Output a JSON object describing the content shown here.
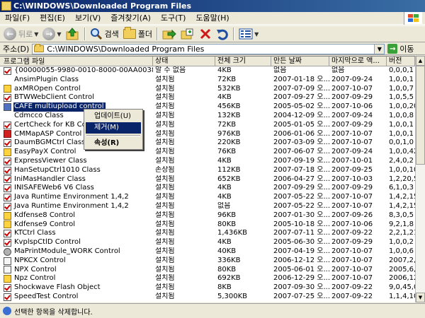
{
  "window": {
    "title": "C:\\WINDOWS\\Downloaded Program Files"
  },
  "menu": [
    "파일(F)",
    "편집(E)",
    "보기(V)",
    "즐겨찾기(A)",
    "도구(T)",
    "도움말(H)"
  ],
  "toolbar": {
    "back_label": "뒤로",
    "search_label": "검색",
    "folders_label": "폴더"
  },
  "address": {
    "label": "주소(D)",
    "value": "C:\\WINDOWS\\Downloaded Program Files",
    "go_label": "이동"
  },
  "columns": [
    "프로그램 파일",
    "상태",
    "전체 크기",
    "만든 날짜",
    "마지막으로 액...",
    "버전"
  ],
  "rows": [
    {
      "name": "{00000055-9980-0010-8000-00AA00389B71}",
      "status": "알 수 없음",
      "size": "4KB",
      "created": "없음",
      "last": "없음",
      "version": "0,0,0,1",
      "icon": "check"
    },
    {
      "name": "AnsimPlugin Class",
      "status": "설치됨",
      "size": "72KB",
      "created": "2007-01-18 오...",
      "last": "2007-09-24",
      "version": "1,0,0,1",
      "icon": "none"
    },
    {
      "name": "axMROpen Control",
      "status": "설치됨",
      "size": "532KB",
      "created": "2007-07-09 오...",
      "last": "2007-10-07",
      "version": "1,0,0,7",
      "icon": "warn"
    },
    {
      "name": "BTWWebClient Control",
      "status": "설치됨",
      "size": "4KB",
      "created": "2007-09-27 오...",
      "last": "2007-09-29",
      "version": "1,0,5,5",
      "icon": "check"
    },
    {
      "name": "CAFE multiupload control",
      "status": "설치됨",
      "size": "456KB",
      "created": "2005-05-02 오...",
      "last": "2007-10-06",
      "version": "1,0,0,20",
      "icon": "blue",
      "selected": true
    },
    {
      "name": "Cdmcco Class",
      "status": "설치됨",
      "size": "132KB",
      "created": "2004-12-09 오...",
      "last": "2007-09-24",
      "version": "1,0,0,8",
      "icon": "none"
    },
    {
      "name": "CertCheck for KB Contr",
      "status": "설치됨",
      "size": "72KB",
      "created": "2005-01-05 오...",
      "last": "2007-09-29",
      "version": "1,0,0,1",
      "icon": "check"
    },
    {
      "name": "CMMapASP Control",
      "status": "설치됨",
      "size": "976KB",
      "created": "2006-01-06 오...",
      "last": "2007-10-07",
      "version": "1,0,0,1",
      "icon": "red"
    },
    {
      "name": "DaumBGMCtrl Class",
      "status": "설치됨",
      "size": "220KB",
      "created": "2007-03-09 오...",
      "last": "2007-10-07",
      "version": "0,0,1,0",
      "icon": "check"
    },
    {
      "name": "EasyPayX Control",
      "status": "설치됨",
      "size": "76KB",
      "created": "2007-06-07 오...",
      "last": "2007-09-24",
      "version": "1,0,0,42",
      "icon": "warn"
    },
    {
      "name": "ExpressViewer Class",
      "status": "설치됨",
      "size": "4KB",
      "created": "2007-09-19 오...",
      "last": "2007-10-01",
      "version": "2,4,0,2",
      "icon": "check"
    },
    {
      "name": "HanSetupCtrl1010 Class",
      "status": "손상됨",
      "size": "112KB",
      "created": "2007-07-18 오...",
      "last": "2007-09-25",
      "version": "1,0,0,10",
      "icon": "check"
    },
    {
      "name": "IniMasHandler Class",
      "status": "설치됨",
      "size": "652KB",
      "created": "2006-04-27 오...",
      "last": "2007-10-03",
      "version": "1,2,20,5",
      "icon": "check"
    },
    {
      "name": "INISAFEWeb6 V6 Class",
      "status": "설치됨",
      "size": "4KB",
      "created": "2007-09-29 오...",
      "last": "2007-09-29",
      "version": "6,1,0,3",
      "icon": "check"
    },
    {
      "name": "Java Runtime Environment 1,4,2",
      "status": "설치됨",
      "size": "4KB",
      "created": "2007-05-22 오...",
      "last": "2007-10-07",
      "version": "1,4,2,15",
      "icon": "check"
    },
    {
      "name": "Java Runtime Environment 1,4,2",
      "status": "설치됨",
      "size": "없음",
      "created": "2007-05-22 오...",
      "last": "2007-10-07",
      "version": "1,4,2,15",
      "icon": "check"
    },
    {
      "name": "Kdfense8 Control",
      "status": "설치됨",
      "size": "96KB",
      "created": "2007-01-30 오...",
      "last": "2007-09-26",
      "version": "8,3,0,5",
      "icon": "warn"
    },
    {
      "name": "Kdfense9 Control",
      "status": "설치됨",
      "size": "80KB",
      "created": "2005-10-18 오...",
      "last": "2007-10-06",
      "version": "9,2,1,8",
      "icon": "warn"
    },
    {
      "name": "KTCtrl Class",
      "status": "설치됨",
      "size": "1,436KB",
      "created": "2007-07-11 오...",
      "last": "2007-09-22",
      "version": "2,2,1,21",
      "icon": "check"
    },
    {
      "name": "KvplspCtlD Control",
      "status": "설치됨",
      "size": "4KB",
      "created": "2005-06-30 오...",
      "last": "2007-09-29",
      "version": "1,0,0,2",
      "icon": "check"
    },
    {
      "name": "MaPrintModule_WORK Control",
      "status": "설치됨",
      "size": "40KB",
      "created": "2007-04-19 오...",
      "last": "2007-10-07",
      "version": "1,0,0,6",
      "icon": "gear"
    },
    {
      "name": "NPKCX Control",
      "status": "설치됨",
      "size": "336KB",
      "created": "2006-12-12 오...",
      "last": "2007-10-07",
      "version": "2007,2,6",
      "icon": "doc"
    },
    {
      "name": "NPX Control",
      "status": "설치됨",
      "size": "80KB",
      "created": "2005-06-01 오...",
      "last": "2007-10-07",
      "version": "2005,6,1",
      "icon": "doc"
    },
    {
      "name": "Npz Control",
      "status": "설치됨",
      "size": "692KB",
      "created": "2006-12-29 오...",
      "last": "2007-10-07",
      "version": "2006,12,",
      "icon": "warn"
    },
    {
      "name": "Shockwave Flash Object",
      "status": "설치됨",
      "size": "8KB",
      "created": "2007-09-30 오...",
      "last": "2007-09-22",
      "version": "9,0,45,0",
      "icon": "check"
    },
    {
      "name": "SpeedTest Control",
      "status": "설치됨",
      "size": "5,300KB",
      "created": "2007-07-25 오...",
      "last": "2007-09-22",
      "version": "1,1,4,10",
      "icon": "check"
    }
  ],
  "context_menu": [
    "업데이트(U)",
    "제거(M)",
    "속성(R)"
  ],
  "status": {
    "text": "선택한 항목을 삭제합니다."
  }
}
